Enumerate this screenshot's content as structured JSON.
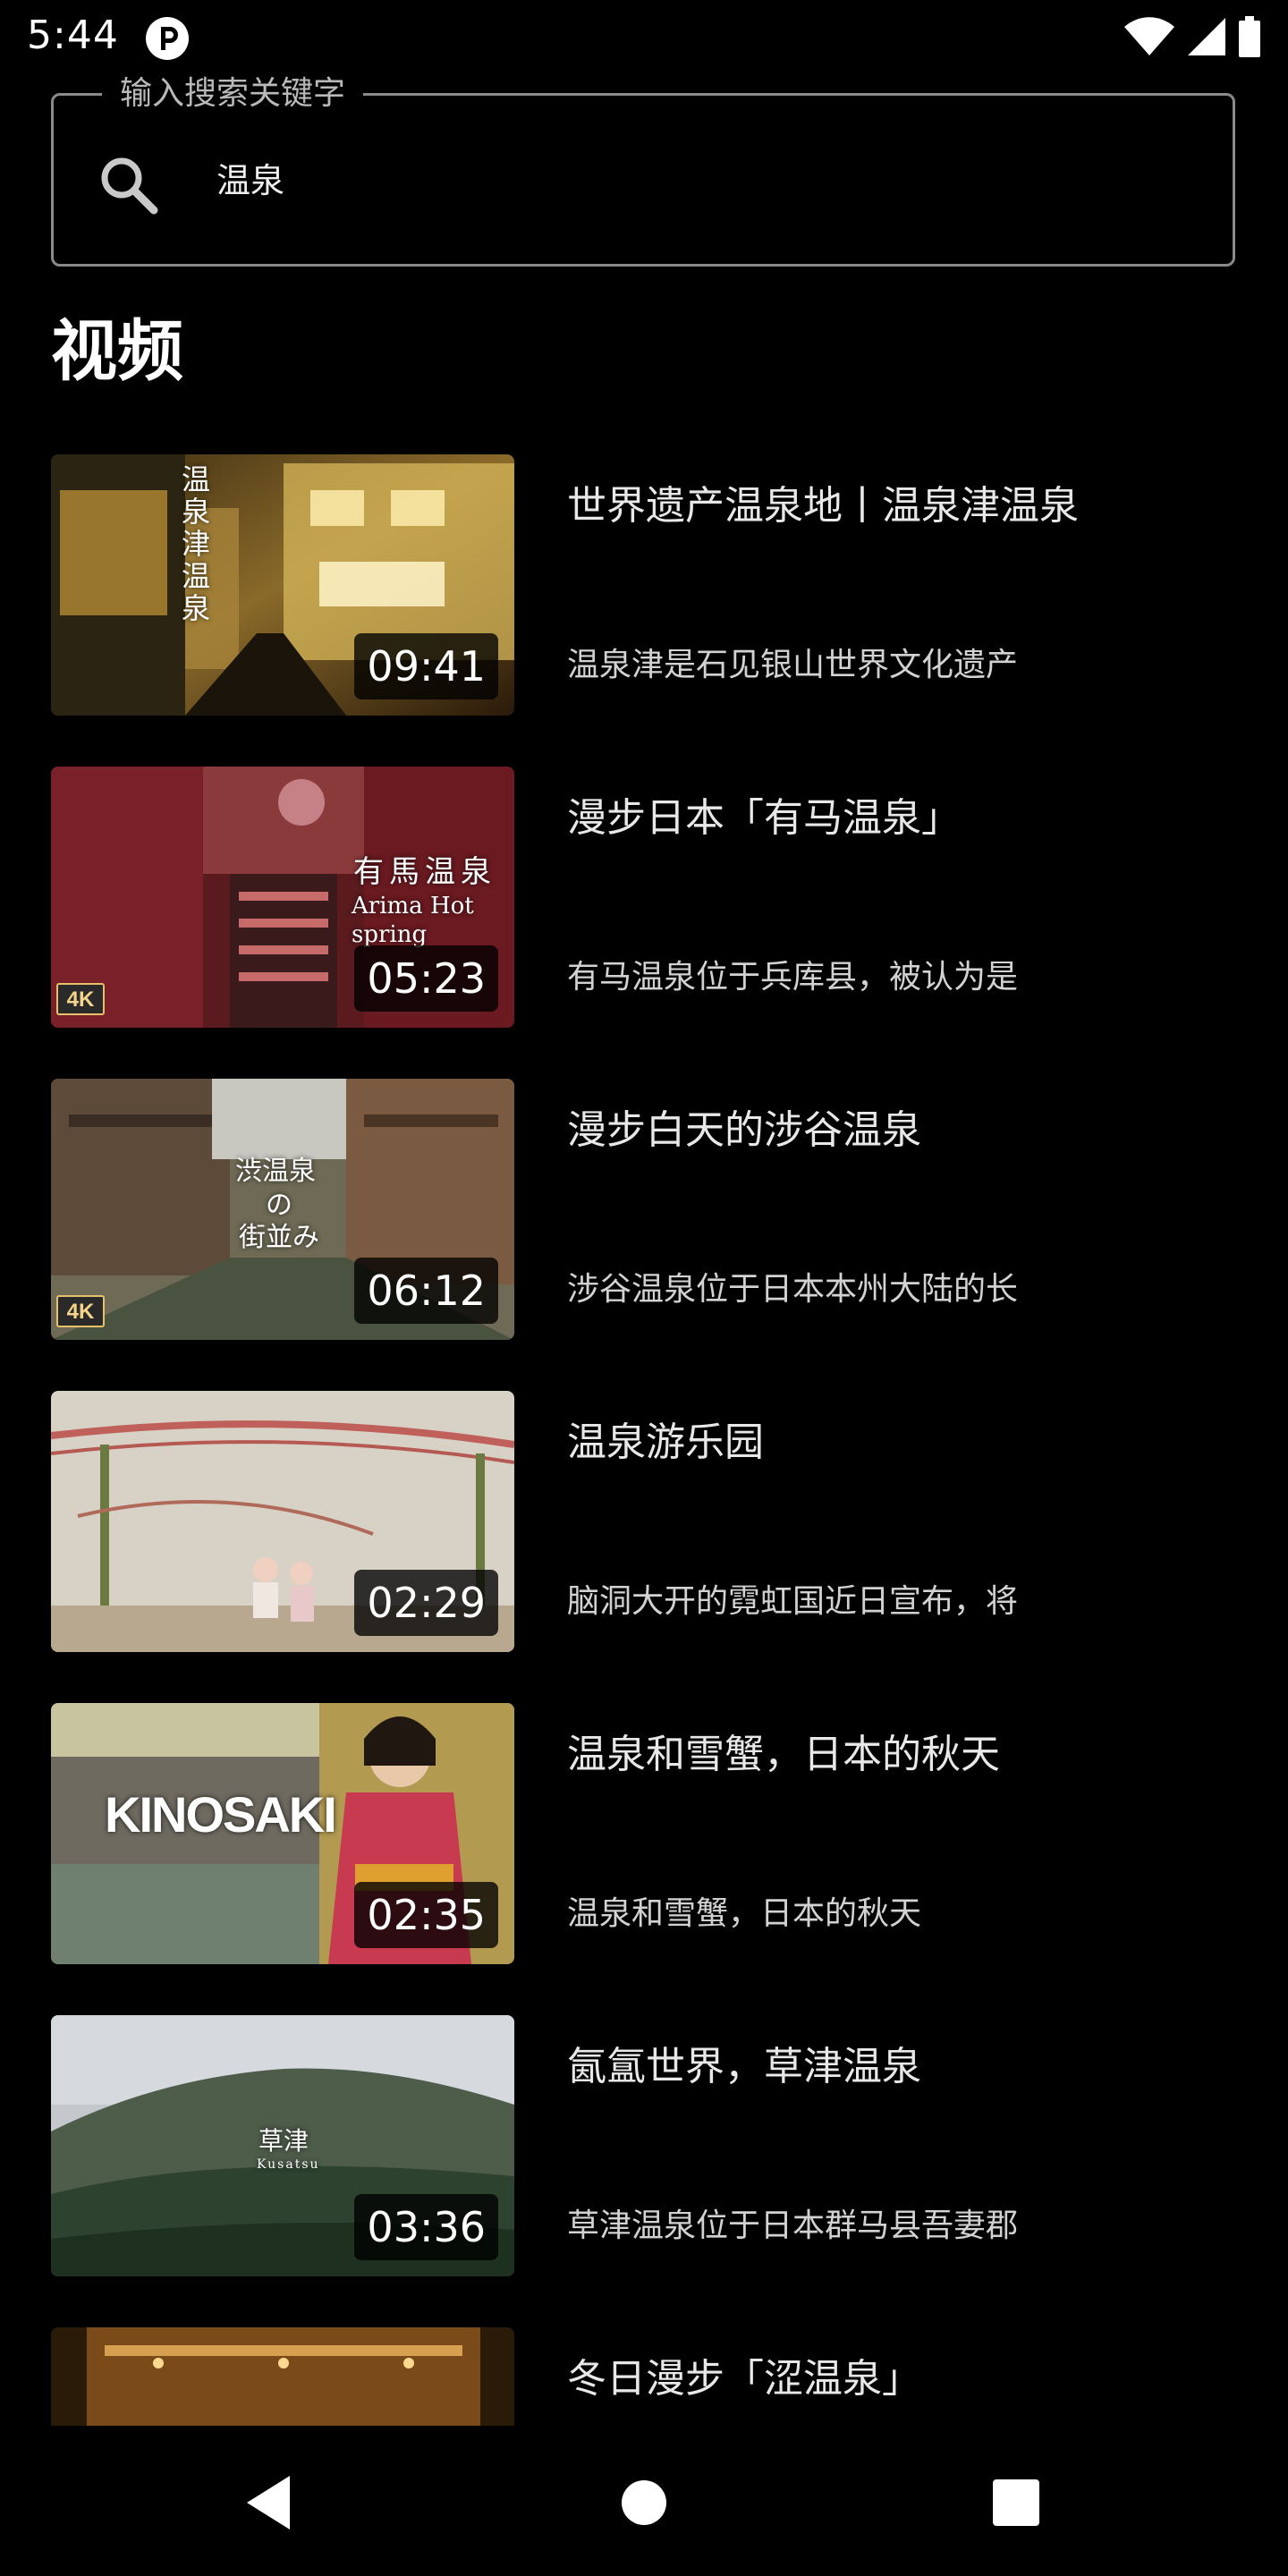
{
  "status_bar": {
    "time": "5:44",
    "app_icon": "pocket-p-icon",
    "icons": [
      "wifi-icon",
      "cellular-signal-icon",
      "battery-icon"
    ]
  },
  "search": {
    "legend": "输入搜索关键字",
    "value": "温泉",
    "icon": "search-icon"
  },
  "section": {
    "title": "视频"
  },
  "videos": [
    {
      "title": "世界遗产温泉地丨温泉津温泉",
      "description": "温泉津是石见银山世界文化遗产",
      "duration": "09:41",
      "thumb_caption": "温泉津温泉",
      "four_k": false
    },
    {
      "title": "漫步日本「有马温泉」",
      "description": "有马温泉位于兵库县，被认为是",
      "duration": "05:23",
      "thumb_caption": "有馬温泉",
      "thumb_caption_sub": "Arima Hot spring",
      "four_k": true,
      "four_k_label": "4K"
    },
    {
      "title": "漫步白天的涉谷温泉",
      "description": "涉谷温泉位于日本本州大陆的长",
      "duration": "06:12",
      "thumb_caption": "渋温泉",
      "thumb_caption_mid": "の",
      "thumb_caption_sub": "街並み",
      "four_k": true,
      "four_k_label": "4K"
    },
    {
      "title": "温泉游乐园",
      "description": "脑洞大开的霓虹国近日宣布，将",
      "duration": "02:29",
      "four_k": false
    },
    {
      "title": "温泉和雪蟹，日本的秋天",
      "description": "温泉和雪蟹，日本的秋天",
      "duration": "02:35",
      "thumb_caption": "KINOSAKI",
      "four_k": false
    },
    {
      "title": "氤氲世界，草津温泉",
      "description": "草津温泉位于日本群马县吾妻郡",
      "duration": "03:36",
      "thumb_caption": "草津",
      "thumb_caption_sub": "Kusatsu",
      "four_k": false
    },
    {
      "title": "冬日漫步「涩温泉」",
      "description": "",
      "duration": "",
      "four_k": false
    }
  ],
  "nav_bar": {
    "icons": [
      "back-triangle-icon",
      "home-circle-icon",
      "recents-square-icon"
    ]
  }
}
